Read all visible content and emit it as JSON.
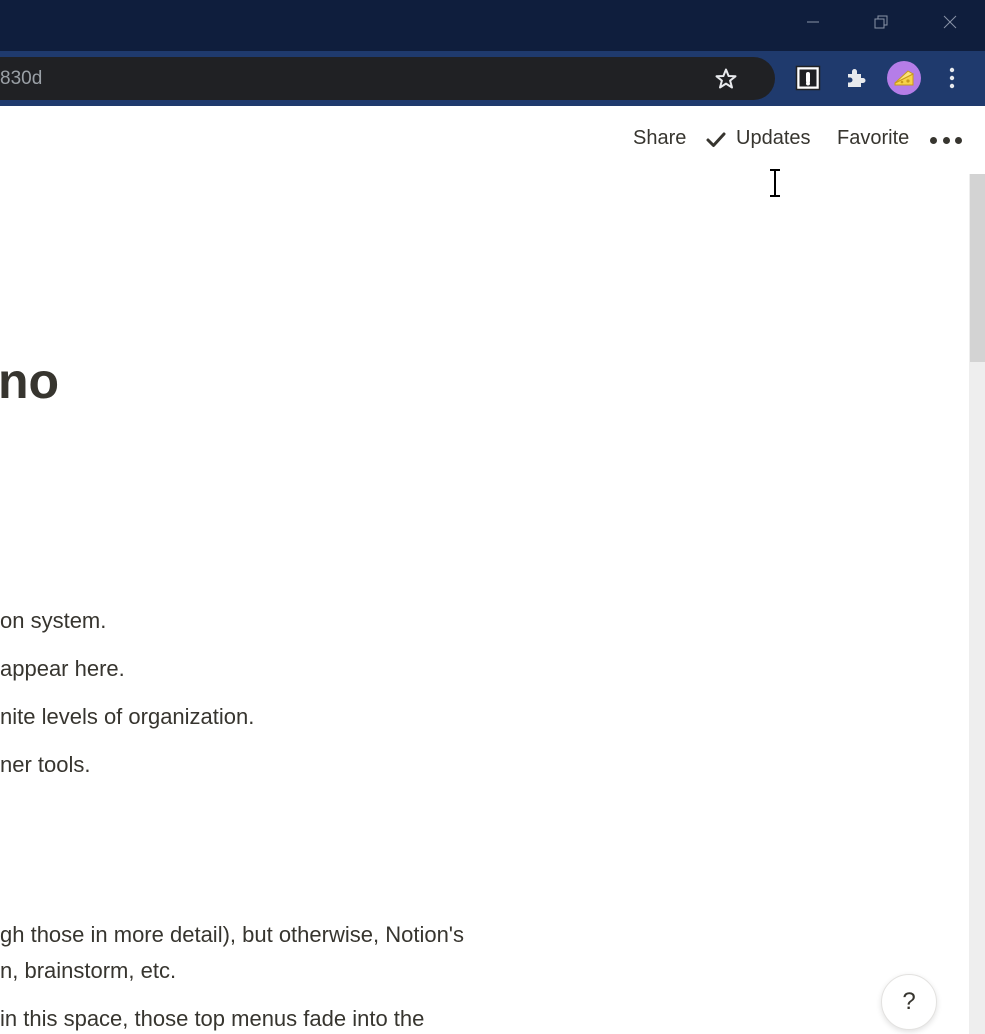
{
  "browser": {
    "url_fragment": "830d"
  },
  "topbar": {
    "share_label": "Share",
    "updates_label": "Updates",
    "favorite_label": "Favorite"
  },
  "page": {
    "heading": "no",
    "lines": [
      "on system.",
      "appear here.",
      "nite levels of organization.",
      "ner tools."
    ],
    "paragraph_lines": [
      "gh those in more detail), but otherwise, Notion's",
      "n, brainstorm, etc.",
      " in this space, those top menus fade into the"
    ]
  },
  "help_button": {
    "label": "?"
  },
  "icons": {
    "window": [
      "minimize-icon",
      "restore-icon",
      "close-icon"
    ],
    "toolbar": [
      "star-icon",
      "extension-icon",
      "puzzle-icon",
      "cheese-avatar-icon",
      "kebab-menu-icon"
    ],
    "page": [
      "check-icon",
      "more-dots-icon",
      "text-cursor-icon"
    ]
  },
  "colors": {
    "titlebar": "#0f1e3d",
    "toolbar": "#1f3a6d",
    "omnibox": "#202124",
    "avatar": "#b57de8",
    "text": "#37352f"
  }
}
